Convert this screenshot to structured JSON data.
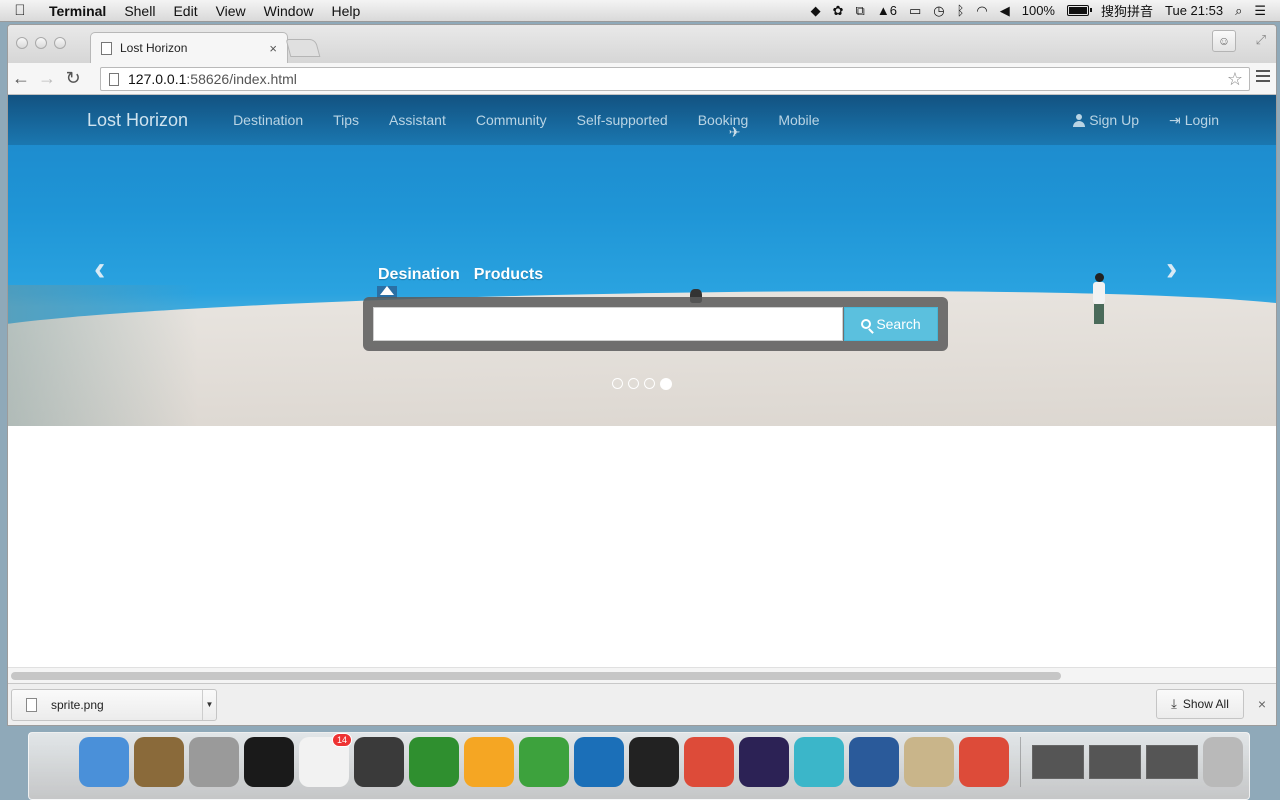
{
  "menubar": {
    "app_name": "Terminal",
    "items": [
      "Shell",
      "Edit",
      "View",
      "Window",
      "Help"
    ],
    "status": {
      "adobe_badge": "6",
      "battery_percent": "100%",
      "input_method": "搜狗拼音",
      "clock": "Tue 21:53"
    }
  },
  "browser": {
    "tab_title": "Lost Horizon",
    "tab_close": "×",
    "url_host": "127.0.0.1",
    "url_rest": ":58626/index.html"
  },
  "site": {
    "brand": "Lost Horizon",
    "nav": [
      "Destination",
      "Tips",
      "Assistant",
      "Community",
      "Self-supported",
      "Booking",
      "Mobile"
    ],
    "sign_up": "Sign Up",
    "login": "Login",
    "search_tabs": [
      "Desination",
      "Products"
    ],
    "search_value": "",
    "search_button": "Search",
    "carousel": {
      "slides": 4,
      "active_index": 4
    }
  },
  "downloads": {
    "file_name": "sprite.png",
    "show_all": "Show All",
    "close": "×"
  },
  "dock": {
    "reminders_badge": "14",
    "apps": [
      {
        "name": "finder-icon",
        "color": "#4a90d9"
      },
      {
        "name": "image-capture-icon",
        "color": "#8a6a3a"
      },
      {
        "name": "calculator-icon",
        "color": "#9a9a9a"
      },
      {
        "name": "terminal-icon",
        "color": "#1a1a1a"
      },
      {
        "name": "reminders-icon",
        "color": "#f2f2f2"
      },
      {
        "name": "sublime-text-icon",
        "color": "#3a3a3a"
      },
      {
        "name": "vim-icon",
        "color": "#2f8f2f"
      },
      {
        "name": "weibo-icon",
        "color": "#f5a623"
      },
      {
        "name": "evernote-icon",
        "color": "#3da23d"
      },
      {
        "name": "brackets-icon",
        "color": "#1b6fb8"
      },
      {
        "name": "qq-icon",
        "color": "#222222"
      },
      {
        "name": "chrome-icon",
        "color": "#dd4b39"
      },
      {
        "name": "eclipse-icon",
        "color": "#2c2255"
      },
      {
        "name": "screen-recorder-icon",
        "color": "#3bb6c9"
      },
      {
        "name": "quicktime-icon",
        "color": "#2a5a9a"
      },
      {
        "name": "preview-icon",
        "color": "#c9b58a"
      },
      {
        "name": "chrome-icon-2",
        "color": "#dd4b39"
      }
    ]
  }
}
